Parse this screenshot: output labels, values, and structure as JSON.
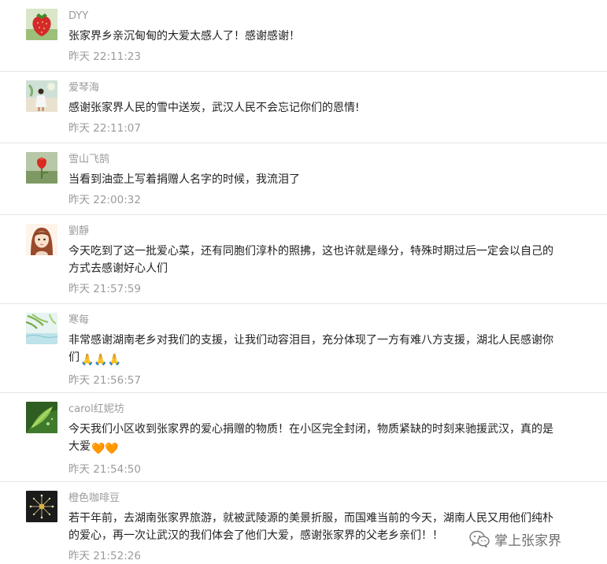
{
  "comments": [
    {
      "name": "DYY",
      "text": "张家界乡亲沉甸甸的大爱太感人了！感谢感谢！",
      "time": "昨天 22:11:23",
      "avatar": "strawberry-avatar"
    },
    {
      "name": "爱琴海",
      "text": "感谢张家界人民的雪中送炭，武汉人民不会忘记你们的恩情!",
      "time": "昨天 22:11:07",
      "avatar": "beach-person-avatar"
    },
    {
      "name": "雪山飞鹄",
      "text": "当看到油壶上写着捐赠人名字的时候，我流泪了",
      "time": "昨天 22:00:32",
      "avatar": "red-flower-avatar"
    },
    {
      "name": "劉靜",
      "text": "今天吃到了这一批爱心菜，还有同胞们淳朴的照拂，这也许就是缘分，特殊时期过后一定会以自己的方式去感谢好心人们",
      "time": "昨天 21:57:59",
      "avatar": "cartoon-girl-avatar"
    },
    {
      "name": "寒每",
      "text": "非常感谢湖南老乡对我们的支援，让我们动容泪目，充分体现了一方有难八方支援，湖北人民感谢你们",
      "emoji": "🙏🙏🙏",
      "time": "昨天 21:56:57",
      "avatar": "bamboo-water-avatar"
    },
    {
      "name": "carol红妮坊",
      "text": "今天我们小区收到张家界的爱心捐赠的物质！在小区完全封闭，物质紧缺的时刻来驰援武汉，真的是大爱",
      "emoji": "🧡🧡",
      "time": "昨天 21:54:50",
      "avatar": "green-leaf-avatar"
    },
    {
      "name": "橙色咖啡豆",
      "text": "若干年前，去湖南张家界旅游，就被武陵源的美景折服，而国难当前的今天，湖南人民又用他们纯朴的爱心，再一次让武汉的我们体会了他们大爱，感谢张家界的父老乡亲们！！",
      "time": "昨天 21:52:26",
      "avatar": "dandelion-avatar"
    }
  ],
  "watermark": {
    "label": "掌上张家界",
    "icon": "wechat-icon"
  }
}
